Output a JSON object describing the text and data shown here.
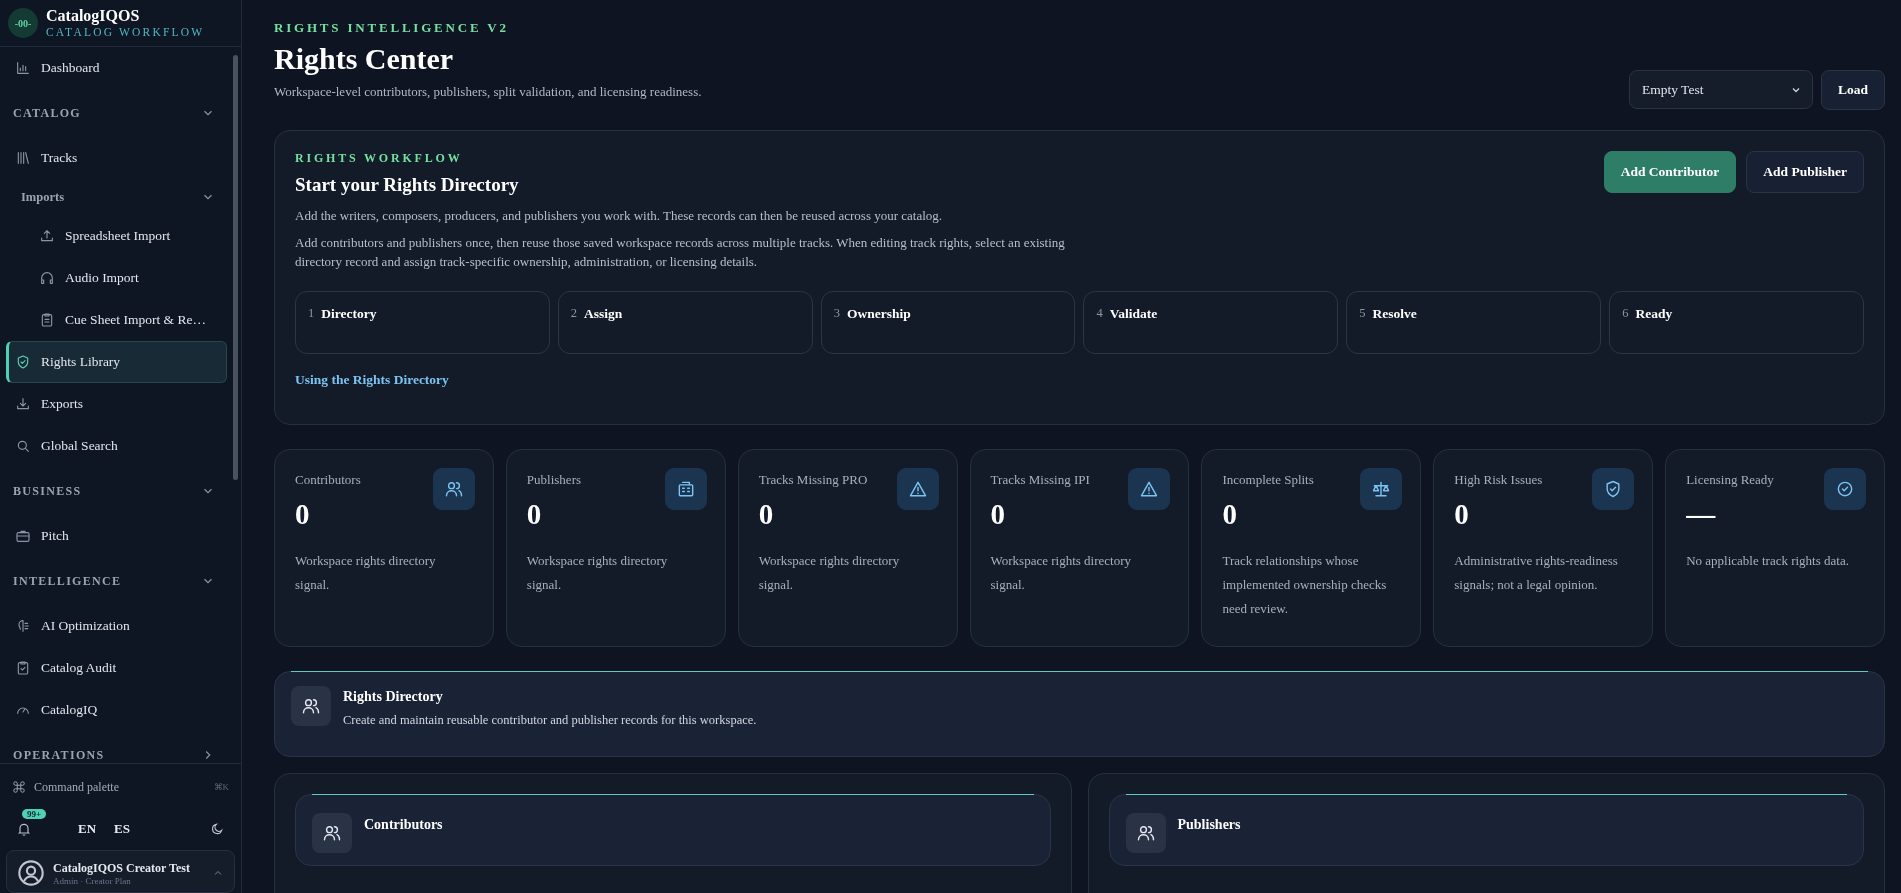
{
  "sidebar": {
    "brand": {
      "logo": "-00-",
      "name": "CatalogIQOS",
      "tagline": "CATALOG WORKFLOW"
    },
    "nav": [
      {
        "kind": "link",
        "label": "Dashboard",
        "selected": false
      },
      {
        "kind": "section",
        "label": "CATALOG",
        "expanded": true,
        "children": [
          {
            "kind": "link",
            "label": "Tracks",
            "selected": false
          },
          {
            "kind": "group",
            "label": "Imports",
            "expanded": true,
            "children": [
              {
                "kind": "link",
                "label": "Spreadsheet Import",
                "selected": false
              },
              {
                "kind": "link",
                "label": "Audio Import",
                "selected": false
              },
              {
                "kind": "link",
                "label": "Cue Sheet Import & Re…",
                "selected": false
              }
            ]
          },
          {
            "kind": "link",
            "label": "Rights Library",
            "selected": true
          },
          {
            "kind": "link",
            "label": "Exports",
            "selected": false
          },
          {
            "kind": "link",
            "label": "Global Search",
            "selected": false
          }
        ]
      },
      {
        "kind": "section",
        "label": "BUSINESS",
        "expanded": true,
        "children": [
          {
            "kind": "link",
            "label": "Pitch",
            "selected": false
          }
        ]
      },
      {
        "kind": "section",
        "label": "INTELLIGENCE",
        "expanded": true,
        "children": [
          {
            "kind": "link",
            "label": "AI Optimization",
            "selected": false
          },
          {
            "kind": "link",
            "label": "Catalog Audit",
            "selected": false
          },
          {
            "kind": "link",
            "label": "CatalogIQ",
            "selected": false
          }
        ]
      },
      {
        "kind": "section",
        "label": "OPERATIONS",
        "expanded": false
      }
    ],
    "command_palette": {
      "label": "Command palette",
      "shortcut": "⌘K"
    },
    "notifications": {
      "badge": "99+"
    },
    "languages": [
      "EN",
      "ES"
    ],
    "user": {
      "name": "CatalogIQOS Creator Test",
      "role": "Admin · Creator Plan"
    }
  },
  "header": {
    "eyebrow": "RIGHTS INTELLIGENCE V2",
    "title": "Rights Center",
    "subtitle": "Workspace-level contributors, publishers, split validation, and licensing readiness.",
    "workspace_select": {
      "value": "Empty Test"
    },
    "load_button": "Load"
  },
  "workflow": {
    "eyebrow": "RIGHTS WORKFLOW",
    "title": "Start your Rights Directory",
    "paragraphs": [
      "Add the writers, composers, producers, and publishers you work with. These records can then be reused across your catalog.",
      "Add contributors and publishers once, then reuse those saved workspace records across multiple tracks. When editing track rights, select an existing directory record and assign track-specific ownership, administration, or licensing details."
    ],
    "buttons": [
      {
        "label": "Add Contributor",
        "kind": "primary"
      },
      {
        "label": "Add Publisher",
        "kind": "secondary"
      }
    ],
    "steps": [
      {
        "number": "1",
        "label": "Directory"
      },
      {
        "number": "2",
        "label": "Assign"
      },
      {
        "number": "3",
        "label": "Ownership"
      },
      {
        "number": "4",
        "label": "Validate"
      },
      {
        "number": "5",
        "label": "Resolve"
      },
      {
        "number": "6",
        "label": "Ready"
      }
    ],
    "link": "Using the Rights Directory"
  },
  "stats": [
    {
      "label": "Contributors",
      "value": "0",
      "description": "Workspace rights directory signal."
    },
    {
      "label": "Publishers",
      "value": "0",
      "description": "Workspace rights directory signal."
    },
    {
      "label": "Tracks Missing PRO",
      "value": "0",
      "description": "Workspace rights directory signal."
    },
    {
      "label": "Tracks Missing IPI",
      "value": "0",
      "description": "Workspace rights directory signal."
    },
    {
      "label": "Incomplete Splits",
      "value": "0",
      "description": "Track relationships whose implemented ownership checks need review."
    },
    {
      "label": "High Risk Issues",
      "value": "0",
      "description": "Administrative rights-readiness signals; not a legal opinion."
    },
    {
      "label": "Licensing Ready",
      "value": "—",
      "description": "No applicable track rights data."
    }
  ],
  "directory": {
    "title": "Rights Directory",
    "description": "Create and maintain reusable contributor and publisher records for this workspace."
  },
  "panels": [
    {
      "title": "Contributors"
    },
    {
      "title": "Publishers"
    }
  ]
}
